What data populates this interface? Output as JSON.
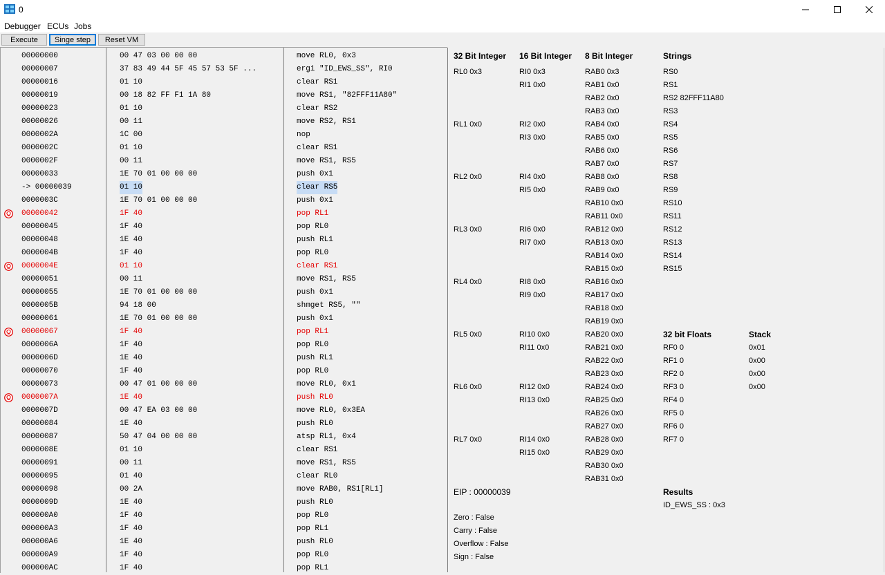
{
  "window": {
    "title": "0"
  },
  "menu": [
    "Debugger",
    "ECUs",
    "Jobs"
  ],
  "toolbar": {
    "execute": "Execute",
    "single_step": "Singe step",
    "reset": "Reset VM"
  },
  "disasm": {
    "rows": [
      {
        "addr": "00000000",
        "bytes": "00 47 03 00 00 00",
        "instr": "move RL0, 0x3"
      },
      {
        "addr": "00000007",
        "bytes": "37 83 49 44 5F 45 57 53 5F ...",
        "instr": "ergi \"ID_EWS_SS\", RI0"
      },
      {
        "addr": "00000016",
        "bytes": "01 10",
        "instr": "clear RS1"
      },
      {
        "addr": "00000019",
        "bytes": "00 18 82 FF F1 1A 80",
        "instr": "move RS1, \"82FFF11A80\""
      },
      {
        "addr": "00000023",
        "bytes": "01 10",
        "instr": "clear RS2"
      },
      {
        "addr": "00000026",
        "bytes": "00 11",
        "instr": "move RS2, RS1"
      },
      {
        "addr": "0000002A",
        "bytes": "1C 00",
        "instr": "nop"
      },
      {
        "addr": "0000002C",
        "bytes": "01 10",
        "instr": "clear RS1"
      },
      {
        "addr": "0000002F",
        "bytes": "00 11",
        "instr": "move RS1, RS5"
      },
      {
        "addr": "00000033",
        "bytes": "1E 70 01 00 00 00",
        "instr": "push 0x1"
      },
      {
        "addr": "-> 00000039",
        "bytes": "01 10",
        "instr": "clear RS5",
        "current": true
      },
      {
        "addr": "0000003C",
        "bytes": "1E 70 01 00 00 00",
        "instr": "push 0x1"
      },
      {
        "addr": "00000042",
        "bytes": "1F 40",
        "instr": "pop RL1",
        "bp": true
      },
      {
        "addr": "00000045",
        "bytes": "1F 40",
        "instr": "pop RL0"
      },
      {
        "addr": "00000048",
        "bytes": "1E 40",
        "instr": "push RL1"
      },
      {
        "addr": "0000004B",
        "bytes": "1F 40",
        "instr": "pop RL0"
      },
      {
        "addr": "0000004E",
        "bytes": "01 10",
        "instr": "clear RS1",
        "bp": true
      },
      {
        "addr": "00000051",
        "bytes": "00 11",
        "instr": "move RS1, RS5"
      },
      {
        "addr": "00000055",
        "bytes": "1E 70 01 00 00 00",
        "instr": "push 0x1"
      },
      {
        "addr": "0000005B",
        "bytes": "94 18 00",
        "instr": "shmget RS5, \"\""
      },
      {
        "addr": "00000061",
        "bytes": "1E 70 01 00 00 00",
        "instr": "push 0x1"
      },
      {
        "addr": "00000067",
        "bytes": "1F 40",
        "instr": "pop RL1",
        "bp": true
      },
      {
        "addr": "0000006A",
        "bytes": "1F 40",
        "instr": "pop RL0"
      },
      {
        "addr": "0000006D",
        "bytes": "1E 40",
        "instr": "push RL1"
      },
      {
        "addr": "00000070",
        "bytes": "1F 40",
        "instr": "pop RL0"
      },
      {
        "addr": "00000073",
        "bytes": "00 47 01 00 00 00",
        "instr": "move RL0, 0x1"
      },
      {
        "addr": "0000007A",
        "bytes": "1E 40",
        "instr": "push RL0",
        "bp": true
      },
      {
        "addr": "0000007D",
        "bytes": "00 47 EA 03 00 00",
        "instr": "move RL0, 0x3EA"
      },
      {
        "addr": "00000084",
        "bytes": "1E 40",
        "instr": "push RL0"
      },
      {
        "addr": "00000087",
        "bytes": "50 47 04 00 00 00",
        "instr": "atsp RL1, 0x4"
      },
      {
        "addr": "0000008E",
        "bytes": "01 10",
        "instr": "clear RS1"
      },
      {
        "addr": "00000091",
        "bytes": "00 11",
        "instr": "move RS1, RS5"
      },
      {
        "addr": "00000095",
        "bytes": "01 40",
        "instr": "clear RL0"
      },
      {
        "addr": "00000098",
        "bytes": "00 2A",
        "instr": "move RAB0, RS1[RL1]"
      },
      {
        "addr": "0000009D",
        "bytes": "1E 40",
        "instr": "push RL0"
      },
      {
        "addr": "000000A0",
        "bytes": "1F 40",
        "instr": "pop RL0"
      },
      {
        "addr": "000000A3",
        "bytes": "1F 40",
        "instr": "pop RL1"
      },
      {
        "addr": "000000A6",
        "bytes": "1E 40",
        "instr": "push RL0"
      },
      {
        "addr": "000000A9",
        "bytes": "1F 40",
        "instr": "pop RL0"
      },
      {
        "addr": "000000AC",
        "bytes": "1F 40",
        "instr": "pop RL1"
      }
    ]
  },
  "registers": {
    "headers": {
      "i32": "32 Bit Integer",
      "i16": "16 Bit Integer",
      "i8": "8 Bit Integer",
      "strings": "Strings",
      "floats": "32 bit Floats",
      "stack": "Stack",
      "results": "Results"
    },
    "rl": [
      "RL0 0x3",
      "RL1 0x0",
      "RL2 0x0",
      "RL3 0x0",
      "RL4 0x0",
      "RL5 0x0",
      "RL6 0x0",
      "RL7 0x0"
    ],
    "ri": [
      "RI0 0x3",
      "RI1 0x0",
      "RI2 0x0",
      "RI3 0x0",
      "RI4 0x0",
      "RI5 0x0",
      "RI6 0x0",
      "RI7 0x0",
      "RI8 0x0",
      "RI9 0x0",
      "RI10 0x0",
      "RI11 0x0",
      "RI12 0x0",
      "RI13 0x0",
      "RI14 0x0",
      "RI15 0x0"
    ],
    "rab": [
      "RAB0 0x3",
      "RAB1 0x0",
      "RAB2 0x0",
      "RAB3 0x0",
      "RAB4 0x0",
      "RAB5 0x0",
      "RAB6 0x0",
      "RAB7 0x0",
      "RAB8 0x0",
      "RAB9 0x0",
      "RAB10 0x0",
      "RAB11 0x0",
      "RAB12 0x0",
      "RAB13 0x0",
      "RAB14 0x0",
      "RAB15 0x0",
      "RAB16 0x0",
      "RAB17 0x0",
      "RAB18 0x0",
      "RAB19 0x0",
      "RAB20 0x0",
      "RAB21 0x0",
      "RAB22 0x0",
      "RAB23 0x0",
      "RAB24 0x0",
      "RAB25 0x0",
      "RAB26 0x0",
      "RAB27 0x0",
      "RAB28 0x0",
      "RAB29 0x0",
      "RAB30 0x0",
      "RAB31 0x0"
    ],
    "rs": [
      "RS0",
      "RS1",
      "RS2 82FFF11A80",
      "RS3",
      "RS4",
      "RS5",
      "RS6",
      "RS7",
      "RS8",
      "RS9",
      "RS10",
      "RS11",
      "RS12",
      "RS13",
      "RS14",
      "RS15"
    ],
    "rf": [
      "RF0 0",
      "RF1 0",
      "RF2 0",
      "RF3 0",
      "RF4 0",
      "RF5 0",
      "RF6 0",
      "RF7 0"
    ],
    "stack": [
      "0x01",
      "0x00",
      "0x00",
      "0x00"
    ],
    "eip": "EIP : 00000039",
    "flags": [
      "Zero : False",
      "Carry : False",
      "Overflow : False",
      "Sign : False"
    ],
    "results": [
      "ID_EWS_SS : 0x3"
    ]
  },
  "colors": {
    "breakpoint": "#e30000",
    "current_highlight": "#c7dcf5",
    "focus": "#0078d7"
  }
}
